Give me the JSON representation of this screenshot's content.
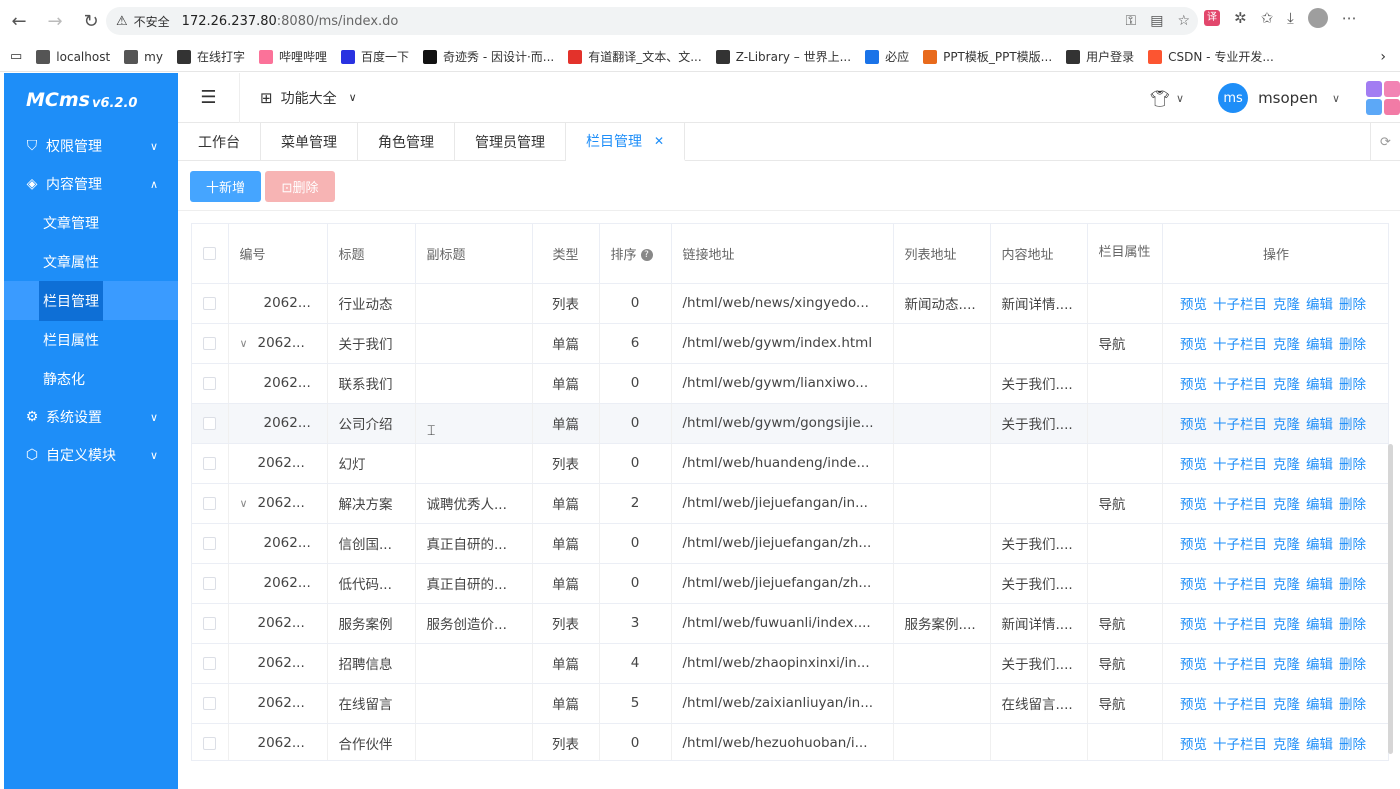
{
  "browser": {
    "warning": "不安全",
    "url_host": "172.26.237.80",
    "url_path": ":8080/ms/index.do"
  },
  "bookmarks": [
    {
      "label": "localhost",
      "icon": "folder-icon",
      "color": "#555"
    },
    {
      "label": "my",
      "icon": "folder-icon",
      "color": "#555"
    },
    {
      "label": "在线打字",
      "icon": "globe-icon",
      "color": "#333"
    },
    {
      "label": "哔哩哔哩",
      "icon": "bilibili-icon",
      "color": "#fb7299"
    },
    {
      "label": "百度一下",
      "icon": "baidu-icon",
      "color": "#2932e1"
    },
    {
      "label": "奇迹秀 - 因设计·而...",
      "icon": "qjx-icon",
      "color": "#111"
    },
    {
      "label": "有道翻译_文本、文...",
      "icon": "youdao-icon",
      "color": "#e3322b"
    },
    {
      "label": "Z-Library – 世界上...",
      "icon": "zlib-icon",
      "color": "#333"
    },
    {
      "label": "必应",
      "icon": "search-icon",
      "color": "#1a73e8"
    },
    {
      "label": "PPT模板_PPT模版...",
      "icon": "ppt-icon",
      "color": "#e86a1c"
    },
    {
      "label": "用户登录",
      "icon": "globe-icon",
      "color": "#333"
    },
    {
      "label": "CSDN - 专业开发...",
      "icon": "csdn-icon",
      "color": "#fc5531"
    }
  ],
  "sidebar": {
    "logo": "MCms",
    "version": "v6.2.0",
    "menu": [
      {
        "label": "权限管理",
        "icon": "shield-icon",
        "expanded": false
      },
      {
        "label": "内容管理",
        "icon": "layers-icon",
        "expanded": true,
        "children": [
          {
            "label": "文章管理",
            "active": false
          },
          {
            "label": "文章属性",
            "active": false
          },
          {
            "label": "栏目管理",
            "active": true
          },
          {
            "label": "栏目属性",
            "active": false
          },
          {
            "label": "静态化",
            "active": false
          }
        ]
      },
      {
        "label": "系统设置",
        "icon": "gear-icon",
        "expanded": false
      },
      {
        "label": "自定义模块",
        "icon": "module-icon",
        "expanded": false
      }
    ]
  },
  "topbar": {
    "functions_label": "功能大全",
    "username": "msopen",
    "avatar_text": "ms"
  },
  "tabs": [
    {
      "label": "工作台",
      "active": false
    },
    {
      "label": "菜单管理",
      "active": false
    },
    {
      "label": "角色管理",
      "active": false
    },
    {
      "label": "管理员管理",
      "active": false
    },
    {
      "label": "栏目管理",
      "active": true,
      "closable": true
    }
  ],
  "toolbar": {
    "add_label": "十新增",
    "delete_label": "⊡删除"
  },
  "table": {
    "columns": [
      "编号",
      "标题",
      "副标题",
      "类型",
      "排序",
      "链接地址",
      "列表地址",
      "内容地址",
      "栏目属性",
      "操作"
    ],
    "operations": [
      "预览",
      "十子栏目",
      "克隆",
      "编辑",
      "删除"
    ],
    "rows": [
      {
        "id": "2062...",
        "indent": true,
        "expand": false,
        "title": "行业动态",
        "subtitle": "",
        "type": "列表",
        "sort": "0",
        "link": "/html/web/news/xingyedo...",
        "list": "新闻动态....",
        "content": "新闻详情....",
        "attr": ""
      },
      {
        "id": "2062...",
        "indent": false,
        "expand": true,
        "title": "关于我们",
        "subtitle": "",
        "type": "单篇",
        "sort": "6",
        "link": "/html/web/gywm/index.html",
        "list": "",
        "content": "",
        "attr": "导航"
      },
      {
        "id": "2062...",
        "indent": true,
        "expand": false,
        "title": "联系我们",
        "subtitle": "",
        "type": "单篇",
        "sort": "0",
        "link": "/html/web/gywm/lianxiwo...",
        "list": "",
        "content": "关于我们....",
        "attr": ""
      },
      {
        "id": "2062...",
        "indent": true,
        "expand": false,
        "title": "公司介绍",
        "subtitle": "",
        "type": "单篇",
        "sort": "0",
        "link": "/html/web/gywm/gongsijie...",
        "list": "",
        "content": "关于我们....",
        "attr": "",
        "hover": true
      },
      {
        "id": "2062...",
        "indent": false,
        "expand": false,
        "title": "幻灯",
        "subtitle": "",
        "type": "列表",
        "sort": "0",
        "link": "/html/web/huandeng/inde...",
        "list": "",
        "content": "",
        "attr": ""
      },
      {
        "id": "2062...",
        "indent": false,
        "expand": true,
        "title": "解决方案",
        "subtitle": "诚聘优秀人...",
        "type": "单篇",
        "sort": "2",
        "link": "/html/web/jiejuefangan/in...",
        "list": "",
        "content": "",
        "attr": "导航"
      },
      {
        "id": "2062...",
        "indent": true,
        "expand": false,
        "title": "信创国...",
        "subtitle": "真正自研的...",
        "type": "单篇",
        "sort": "0",
        "link": "/html/web/jiejuefangan/zh...",
        "list": "",
        "content": "关于我们....",
        "attr": ""
      },
      {
        "id": "2062...",
        "indent": true,
        "expand": false,
        "title": "低代码...",
        "subtitle": "真正自研的...",
        "type": "单篇",
        "sort": "0",
        "link": "/html/web/jiejuefangan/zh...",
        "list": "",
        "content": "关于我们....",
        "attr": ""
      },
      {
        "id": "2062...",
        "indent": false,
        "expand": false,
        "title": "服务案例",
        "subtitle": "服务创造价...",
        "type": "列表",
        "sort": "3",
        "link": "/html/web/fuwuanli/index....",
        "list": "服务案例....",
        "content": "新闻详情....",
        "attr": "导航"
      },
      {
        "id": "2062...",
        "indent": false,
        "expand": false,
        "title": "招聘信息",
        "subtitle": "",
        "type": "单篇",
        "sort": "4",
        "link": "/html/web/zhaopinxinxi/in...",
        "list": "",
        "content": "关于我们....",
        "attr": "导航"
      },
      {
        "id": "2062...",
        "indent": false,
        "expand": false,
        "title": "在线留言",
        "subtitle": "",
        "type": "单篇",
        "sort": "5",
        "link": "/html/web/zaixianliuyan/in...",
        "list": "",
        "content": "在线留言....",
        "attr": "导航"
      },
      {
        "id": "2062...",
        "indent": false,
        "expand": false,
        "title": "合作伙伴",
        "subtitle": "",
        "type": "列表",
        "sort": "0",
        "link": "/html/web/hezuohuoban/i...",
        "list": "",
        "content": "",
        "attr": ""
      }
    ]
  }
}
